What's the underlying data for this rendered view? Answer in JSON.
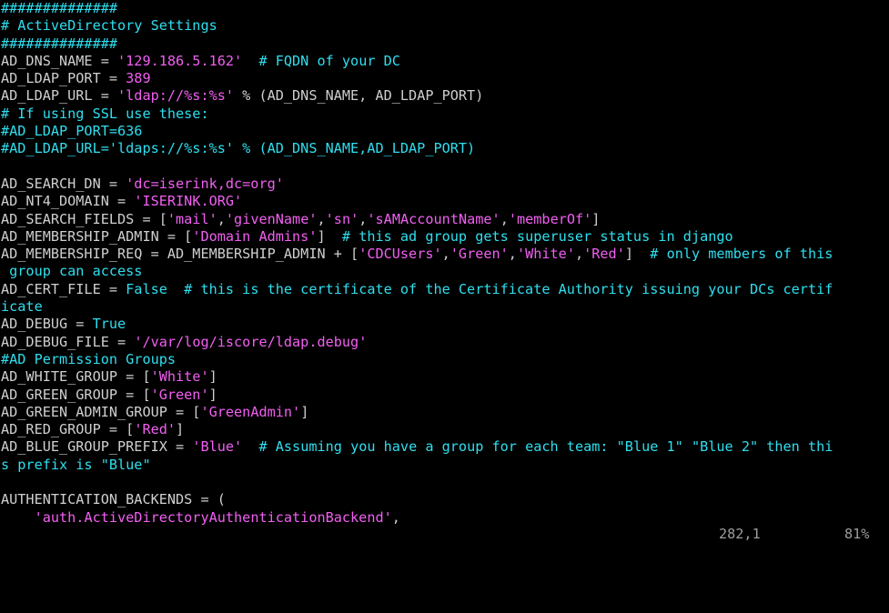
{
  "app": {
    "type": "terminal-text-editor",
    "filename_visible": false
  },
  "colors": {
    "background": "#000000",
    "identifier": "#cfcfcf",
    "comment": "#2fdfef",
    "string": "#f25ff2",
    "number": "#f25ff2",
    "keyword": "#2fdfef",
    "status_text": "#9d9d9d"
  },
  "editor": {
    "columns": 98,
    "rows": 31,
    "lines": [
      {
        "id": "l1",
        "text": "##############",
        "spans": [
          {
            "t": "##############",
            "c": "comment"
          }
        ]
      },
      {
        "id": "l2",
        "text": "# ActiveDirectory Settings",
        "spans": [
          {
            "t": "# ActiveDirectory Settings",
            "c": "comment"
          }
        ]
      },
      {
        "id": "l3",
        "text": "##############",
        "spans": [
          {
            "t": "##############",
            "c": "comment"
          }
        ]
      },
      {
        "id": "l4",
        "text": "AD_DNS_NAME = '129.186.5.162'  # FQDN of your DC",
        "spans": [
          {
            "t": "AD_DNS_NAME = ",
            "c": "ident"
          },
          {
            "t": "'129.186.5.162'",
            "c": "string"
          },
          {
            "t": "  ",
            "c": "ident"
          },
          {
            "t": "# FQDN of your DC",
            "c": "comment"
          }
        ]
      },
      {
        "id": "l5",
        "text": "AD_LDAP_PORT = 389",
        "spans": [
          {
            "t": "AD_LDAP_PORT = ",
            "c": "ident"
          },
          {
            "t": "389",
            "c": "number"
          }
        ]
      },
      {
        "id": "l6",
        "text": "AD_LDAP_URL = 'ldap://%s:%s' % (AD_DNS_NAME, AD_LDAP_PORT)",
        "spans": [
          {
            "t": "AD_LDAP_URL = ",
            "c": "ident"
          },
          {
            "t": "'ldap://%s:%s'",
            "c": "string"
          },
          {
            "t": " % (AD_DNS_NAME, AD_LDAP_PORT)",
            "c": "ident"
          }
        ]
      },
      {
        "id": "l7",
        "text": "# If using SSL use these:",
        "spans": [
          {
            "t": "# If using SSL use these:",
            "c": "comment"
          }
        ]
      },
      {
        "id": "l8",
        "text": "#AD_LDAP_PORT=636",
        "spans": [
          {
            "t": "#AD_LDAP_PORT=636",
            "c": "comment"
          }
        ]
      },
      {
        "id": "l9",
        "text": "#AD_LDAP_URL='ldaps://%s:%s' % (AD_DNS_NAME,AD_LDAP_PORT)",
        "spans": [
          {
            "t": "#AD_LDAP_URL='ldaps://%s:%s' % (AD_DNS_NAME,AD_LDAP_PORT)",
            "c": "comment"
          }
        ]
      },
      {
        "id": "l10",
        "text": "",
        "spans": [
          {
            "t": " ",
            "c": "blank"
          }
        ]
      },
      {
        "id": "l11",
        "text": "AD_SEARCH_DN = 'dc=iserink,dc=org'",
        "spans": [
          {
            "t": "AD_SEARCH_DN = ",
            "c": "ident"
          },
          {
            "t": "'dc=iserink,dc=org'",
            "c": "string"
          }
        ]
      },
      {
        "id": "l12",
        "text": "AD_NT4_DOMAIN = 'ISERINK.ORG'",
        "spans": [
          {
            "t": "AD_NT4_DOMAIN = ",
            "c": "ident"
          },
          {
            "t": "'ISERINK.ORG'",
            "c": "string"
          }
        ]
      },
      {
        "id": "l13",
        "text": "AD_SEARCH_FIELDS = ['mail','givenName','sn','sAMAccountName','memberOf']",
        "spans": [
          {
            "t": "AD_SEARCH_FIELDS = [",
            "c": "ident"
          },
          {
            "t": "'mail'",
            "c": "string"
          },
          {
            "t": ",",
            "c": "ident"
          },
          {
            "t": "'givenName'",
            "c": "string"
          },
          {
            "t": ",",
            "c": "ident"
          },
          {
            "t": "'sn'",
            "c": "string"
          },
          {
            "t": ",",
            "c": "ident"
          },
          {
            "t": "'sAMAccountName'",
            "c": "string"
          },
          {
            "t": ",",
            "c": "ident"
          },
          {
            "t": "'memberOf'",
            "c": "string"
          },
          {
            "t": "]",
            "c": "ident"
          }
        ]
      },
      {
        "id": "l14",
        "text": "AD_MEMBERSHIP_ADMIN = ['Domain Admins']  # this ad group gets superuser status in django",
        "spans": [
          {
            "t": "AD_MEMBERSHIP_ADMIN = [",
            "c": "ident"
          },
          {
            "t": "'Domain Admins'",
            "c": "string"
          },
          {
            "t": "]  ",
            "c": "ident"
          },
          {
            "t": "# this ad group gets superuser status in django",
            "c": "comment"
          }
        ]
      },
      {
        "id": "l15",
        "text": "AD_MEMBERSHIP_REQ = AD_MEMBERSHIP_ADMIN + ['CDCUsers','Green','White','Red']  # only members of this",
        "spans": [
          {
            "t": "AD_MEMBERSHIP_REQ = AD_MEMBERSHIP_ADMIN + [",
            "c": "ident"
          },
          {
            "t": "'CDCUsers'",
            "c": "string"
          },
          {
            "t": ",",
            "c": "ident"
          },
          {
            "t": "'Green'",
            "c": "string"
          },
          {
            "t": ",",
            "c": "ident"
          },
          {
            "t": "'White'",
            "c": "string"
          },
          {
            "t": ",",
            "c": "ident"
          },
          {
            "t": "'Red'",
            "c": "string"
          },
          {
            "t": "]  ",
            "c": "ident"
          },
          {
            "t": "# only members of this",
            "c": "comment"
          }
        ]
      },
      {
        "id": "l16",
        "text": " group can access",
        "spans": [
          {
            "t": " group can access",
            "c": "comment"
          }
        ]
      },
      {
        "id": "l17",
        "text": "AD_CERT_FILE = False  # this is the certificate of the Certificate Authority issuing your DCs certif",
        "spans": [
          {
            "t": "AD_CERT_FILE = ",
            "c": "ident"
          },
          {
            "t": "False",
            "c": "keyword"
          },
          {
            "t": "  ",
            "c": "ident"
          },
          {
            "t": "# this is the certificate of the Certificate Authority issuing your DCs certif",
            "c": "comment"
          }
        ]
      },
      {
        "id": "l18",
        "text": "icate",
        "spans": [
          {
            "t": "icate",
            "c": "comment"
          }
        ]
      },
      {
        "id": "l19",
        "text": "AD_DEBUG = True",
        "spans": [
          {
            "t": "AD_DEBUG = ",
            "c": "ident"
          },
          {
            "t": "True",
            "c": "keyword"
          }
        ]
      },
      {
        "id": "l20",
        "text": "AD_DEBUG_FILE = '/var/log/iscore/ldap.debug'",
        "spans": [
          {
            "t": "AD_DEBUG_FILE = ",
            "c": "ident"
          },
          {
            "t": "'/var/log/iscore/ldap.debug'",
            "c": "string"
          }
        ]
      },
      {
        "id": "l21",
        "text": "#AD Permission Groups",
        "spans": [
          {
            "t": "#AD Permission Groups",
            "c": "comment"
          }
        ]
      },
      {
        "id": "l22",
        "text": "AD_WHITE_GROUP = ['White']",
        "spans": [
          {
            "t": "AD_WHITE_GROUP = [",
            "c": "ident"
          },
          {
            "t": "'White'",
            "c": "string"
          },
          {
            "t": "]",
            "c": "ident"
          }
        ]
      },
      {
        "id": "l23",
        "text": "AD_GREEN_GROUP = ['Green']",
        "spans": [
          {
            "t": "AD_GREEN_GROUP = [",
            "c": "ident"
          },
          {
            "t": "'Green'",
            "c": "string"
          },
          {
            "t": "]",
            "c": "ident"
          }
        ]
      },
      {
        "id": "l24",
        "text": "AD_GREEN_ADMIN_GROUP = ['GreenAdmin']",
        "spans": [
          {
            "t": "AD_GREEN_ADMIN_GROUP = [",
            "c": "ident"
          },
          {
            "t": "'GreenAdmin'",
            "c": "string"
          },
          {
            "t": "]",
            "c": "ident"
          }
        ]
      },
      {
        "id": "l25",
        "text": "AD_RED_GROUP = ['Red']",
        "spans": [
          {
            "t": "AD_RED_GROUP = [",
            "c": "ident"
          },
          {
            "t": "'Red'",
            "c": "string"
          },
          {
            "t": "]",
            "c": "ident"
          }
        ]
      },
      {
        "id": "l26",
        "text": "AD_BLUE_GROUP_PREFIX = 'Blue'  # Assuming you have a group for each team: \"Blue 1\" \"Blue 2\" then thi",
        "spans": [
          {
            "t": "AD_BLUE_GROUP_PREFIX = ",
            "c": "ident"
          },
          {
            "t": "'Blue'",
            "c": "string"
          },
          {
            "t": "  ",
            "c": "ident"
          },
          {
            "t": "# Assuming you have a group for each team: \"Blue 1\" \"Blue 2\" then thi",
            "c": "comment"
          }
        ]
      },
      {
        "id": "l27",
        "text": "s prefix is \"Blue\"",
        "spans": [
          {
            "t": "s prefix is \"Blue\"",
            "c": "comment"
          }
        ]
      },
      {
        "id": "l28",
        "text": "",
        "spans": [
          {
            "t": " ",
            "c": "blank"
          }
        ]
      },
      {
        "id": "l29",
        "text": "AUTHENTICATION_BACKENDS = (",
        "spans": [
          {
            "t": "AUTHENTICATION_BACKENDS = (",
            "c": "ident"
          }
        ]
      },
      {
        "id": "l30",
        "text": "    'auth.ActiveDirectoryAuthenticationBackend',",
        "spans": [
          {
            "t": "    ",
            "c": "ident"
          },
          {
            "t": "'auth.ActiveDirectoryAuthenticationBackend'",
            "c": "string"
          },
          {
            "t": ",",
            "c": "ident"
          }
        ]
      }
    ]
  },
  "statusline": {
    "left": "",
    "position": "282,1",
    "percent": "81%"
  }
}
